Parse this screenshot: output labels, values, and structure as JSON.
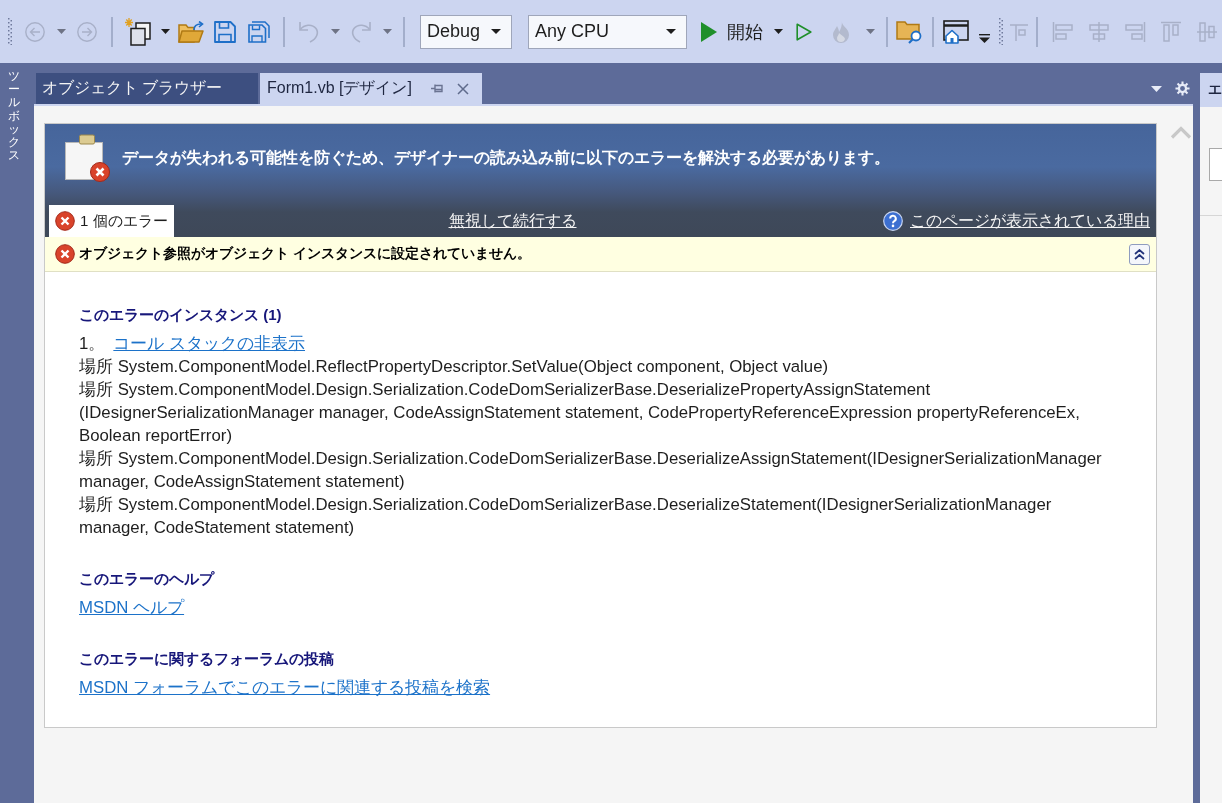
{
  "toolbars": [
    {
      "groups": [
        [
          {
            "kind": "back",
            "disabled": true
          },
          {
            "kind": "caret",
            "disabled": true
          },
          {
            "kind": "forward",
            "disabled": true
          }
        ],
        [
          {
            "kind": "new-project",
            "disabled": false
          },
          {
            "kind": "caret",
            "disabled": false
          },
          {
            "kind": "open",
            "disabled": false
          },
          {
            "kind": "save",
            "disabled": false
          },
          {
            "kind": "save-all",
            "disabled": false
          }
        ],
        [
          {
            "kind": "undo",
            "disabled": true
          },
          {
            "kind": "caret",
            "disabled": true
          },
          {
            "kind": "redo",
            "disabled": true
          },
          {
            "kind": "caret",
            "disabled": true
          }
        ],
        [
          {
            "kind": "combo",
            "value": "Debug",
            "disabled": false
          },
          {
            "kind": "combo",
            "value": "Any CPU",
            "disabled": false
          },
          {
            "kind": "start",
            "label": "開始",
            "disabled": false
          },
          {
            "kind": "caret",
            "disabled": false
          },
          {
            "kind": "run",
            "disabled": false
          },
          {
            "kind": "flame",
            "disabled": true
          },
          {
            "kind": "caret",
            "disabled": true
          }
        ],
        [
          {
            "kind": "find-folder",
            "disabled": false
          }
        ],
        [
          {
            "kind": "window",
            "disabled": false
          },
          {
            "kind": "overflow",
            "disabled": false
          }
        ]
      ]
    },
    {
      "groups": [
        [
          {
            "kind": "align-grid",
            "disabled": true
          }
        ],
        [
          {
            "kind": "align-left",
            "disabled": true
          },
          {
            "kind": "align-center",
            "disabled": true
          },
          {
            "kind": "align-right",
            "disabled": true
          },
          {
            "kind": "align-top",
            "disabled": true
          },
          {
            "kind": "align-middle",
            "disabled": true
          }
        ]
      ]
    }
  ],
  "toolbox": {
    "title": "ツールボックス"
  },
  "tabs": [
    {
      "label": "オブジェクト ブラウザー",
      "selected": false
    },
    {
      "label": "Form1.vb [デザイン]",
      "selected": true
    }
  ],
  "side_panel": {
    "title": "エ"
  },
  "error_page": {
    "title": "データが失われる可能性を防ぐため、デザイナーの読み込み前に以下のエラーを解決する必要があります。",
    "error_tab": "1 個のエラー",
    "ignore_link": "無視して続行する",
    "help_link": "このページが表示されている理由",
    "error": {
      "message": "オブジェクト参照がオブジェクト インスタンスに設定されていません。",
      "expanded": true
    },
    "sections": [
      {
        "kind": "instances",
        "heading": "このエラーのインスタンス (1)",
        "items": [
          {
            "number": "1。",
            "link": "コール スタックの非表示",
            "stack": [
              {
                "lines": [
                  "場所 System.ComponentModel.ReflectPropertyDescriptor.SetValue(Object component, Object value)"
                ]
              },
              {
                "lines": [
                  "場所 System.ComponentModel.Design.Serialization.CodeDomSerializerBase.DeserializePropertyAssignStatement",
                  "(IDesignerSerializationManager manager, CodeAssignStatement statement, CodePropertyReferenceExpression propertyReferenceEx,",
                  "Boolean reportError)"
                ]
              },
              {
                "lines": [
                  "場所 System.ComponentModel.Design.Serialization.CodeDomSerializerBase.DeserializeAssignStatement(IDesignerSerializationManager",
                  "manager, CodeAssignStatement statement)"
                ]
              },
              {
                "lines": [
                  "場所 System.ComponentModel.Design.Serialization.CodeDomSerializerBase.DeserializeStatement(IDesignerSerializationManager",
                  "manager, CodeStatement statement)"
                ]
              }
            ]
          }
        ]
      },
      {
        "kind": "link",
        "heading": "このエラーのヘルプ",
        "link": "MSDN ヘルプ"
      },
      {
        "kind": "link",
        "heading": "このエラーに関するフォーラムの投稿",
        "link": "MSDN フォーラムでこのエラーに関連する投稿を検索"
      }
    ]
  }
}
